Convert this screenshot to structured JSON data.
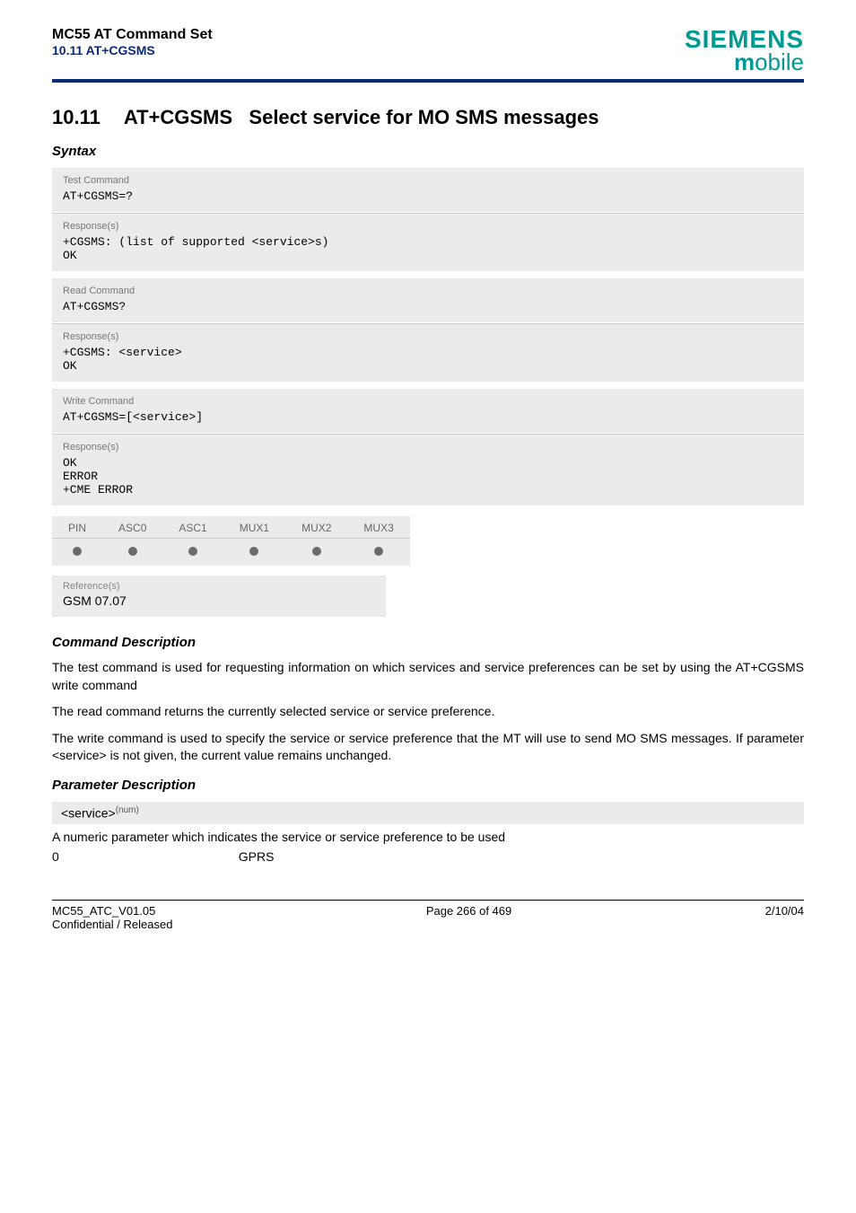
{
  "header": {
    "doc_title": "MC55 AT Command Set",
    "doc_subtitle": "10.11 AT+CGSMS",
    "brand_main": "SIEMENS",
    "brand_sub_m": "m",
    "brand_sub_rest": "obile"
  },
  "heading": {
    "number": "10.11",
    "cmd": "AT+CGSMS",
    "title": "Select service for MO SMS messages"
  },
  "syntax_label": "Syntax",
  "blocks": {
    "test": {
      "label_cmd": "Test Command",
      "code_cmd": "AT+CGSMS=?",
      "label_resp": "Response(s)",
      "code_resp": "+CGSMS: (list of supported <service>s)\nOK"
    },
    "read": {
      "label_cmd": "Read Command",
      "code_cmd": "AT+CGSMS?",
      "label_resp": "Response(s)",
      "code_resp": "+CGSMS: <service>\nOK"
    },
    "write": {
      "label_cmd": "Write Command",
      "code_cmd": "AT+CGSMS=[<service>]",
      "label_resp": "Response(s)",
      "code_resp": "OK\nERROR\n+CME ERROR"
    }
  },
  "support": {
    "headers": [
      "PIN",
      "ASC0",
      "ASC1",
      "MUX1",
      "MUX2",
      "MUX3"
    ]
  },
  "reference": {
    "label": "Reference(s)",
    "text": "GSM 07.07"
  },
  "cmd_desc": {
    "heading": "Command Description",
    "p1": "The test command is used for requesting information on which services and service preferences can be set by using the AT+CGSMS write command",
    "p2": "The read command returns the currently selected service or service preference.",
    "p3": "The write command is used to specify the service or service preference that the MT will use to send MO SMS messages. If parameter <service> is not given, the current value remains unchanged."
  },
  "param_desc": {
    "heading": "Parameter Description",
    "param_name": "<service>",
    "param_tag": "(num)",
    "description": "A numeric parameter which indicates the service or service preference to be used",
    "row0_key": "0",
    "row0_val": "GPRS"
  },
  "footer": {
    "left1": "MC55_ATC_V01.05",
    "left2": "Confidential / Released",
    "center": "Page 266 of 469",
    "right": "2/10/04"
  }
}
